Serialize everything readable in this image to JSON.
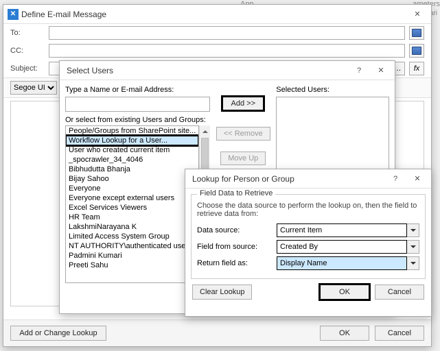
{
  "hints": {
    "appstep": "App Step",
    "params": "ameters",
    "vari": "Vari"
  },
  "mainDialog": {
    "title": "Define E-mail Message",
    "to_label": "To:",
    "cc_label": "CC:",
    "subject_label": "Subject:",
    "font_name": "Segoe UI",
    "footer": {
      "add_lookup": "Add or Change Lookup",
      "ok": "OK",
      "cancel": "Cancel"
    }
  },
  "selectUsers": {
    "title": "Select Users",
    "type_label": "Type a Name or E-mail Address:",
    "existing_label": "Or select from existing Users and Groups:",
    "selected_label": "Selected Users:",
    "add_btn": "Add >>",
    "remove_btn": "<< Remove",
    "moveup_btn": "Move Up",
    "items": [
      "People/Groups from SharePoint site...",
      "Workflow Lookup for a User...",
      "User who created current item",
      "_spocrawler_34_4046",
      "Bibhudutta Bhanja",
      "Bijay Sahoo",
      "Everyone",
      "Everyone except external users",
      "Excel Services Viewers",
      "HR Team",
      "LakshmiNarayana K",
      "Limited Access System Group",
      "NT AUTHORITY\\authenticated users",
      "Padmini Kumari",
      "Preeti Sahu"
    ],
    "selected_index": 1
  },
  "lookupDialog": {
    "title": "Lookup for Person or Group",
    "group_title": "Field Data to Retrieve",
    "help": "Choose the data source to perform the lookup on, then the field to retrieve data from:",
    "datasource_label": "Data source:",
    "datasource_value": "Current Item",
    "field_label": "Field from source:",
    "field_value": "Created By",
    "return_label": "Return field as:",
    "return_value": "Display Name",
    "clear": "Clear Lookup",
    "ok": "OK",
    "cancel": "Cancel"
  }
}
